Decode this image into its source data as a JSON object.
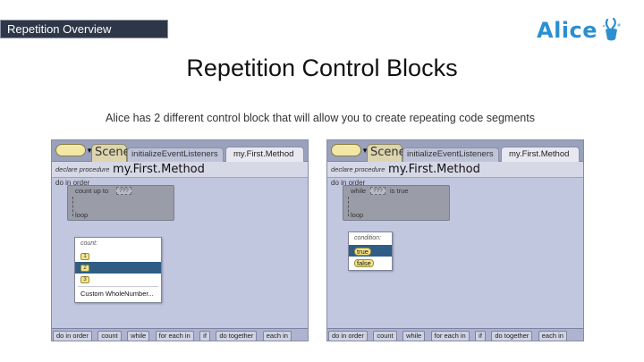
{
  "section_tag": "Repetition Overview",
  "logo": {
    "text": "Alice",
    "mark": "bunny-icon",
    "color": "#2d8fd0"
  },
  "title": "Repetition Control Blocks",
  "subtitle": "Alice has 2 different control block that will allow you to create repeating code segments",
  "screenshots": [
    {
      "scene_tab": "Scene",
      "init_tab": "initializeEventListeners",
      "method_tab": "my.First.Method",
      "declare_keyword": "declare procedure",
      "method_name": "my.First.Method",
      "do_in_order": "do in order",
      "block": {
        "keyword": "count up to",
        "slot": "???",
        "loop": "loop"
      },
      "popup": {
        "title": "count:",
        "items": [
          "1",
          "2",
          "3",
          "Custom WholeNumber..."
        ],
        "selected_index": 1
      },
      "control_bar": [
        "do in order",
        "count",
        "while",
        "for each in",
        "if",
        "do together",
        "each in"
      ]
    },
    {
      "scene_tab": "Scene",
      "init_tab": "initializeEventListeners",
      "method_tab": "my.First.Method",
      "declare_keyword": "declare procedure",
      "method_name": "my.First.Method",
      "do_in_order": "do in order",
      "block": {
        "keyword": "while",
        "slot": "???",
        "keyword_after": "is true",
        "loop": "loop"
      },
      "popup": {
        "title": "condition:",
        "items": [
          "true",
          "false"
        ],
        "selected_index": 0
      },
      "control_bar": [
        "do in order",
        "count",
        "while",
        "for each in",
        "if",
        "do together",
        "each in"
      ]
    }
  ],
  "colors": {
    "window": "#a9b1d1",
    "canvas": "#c2c7e0",
    "block": "#9a9ca8",
    "selection": "#2f5d86",
    "tag_background": "#2e3748"
  }
}
